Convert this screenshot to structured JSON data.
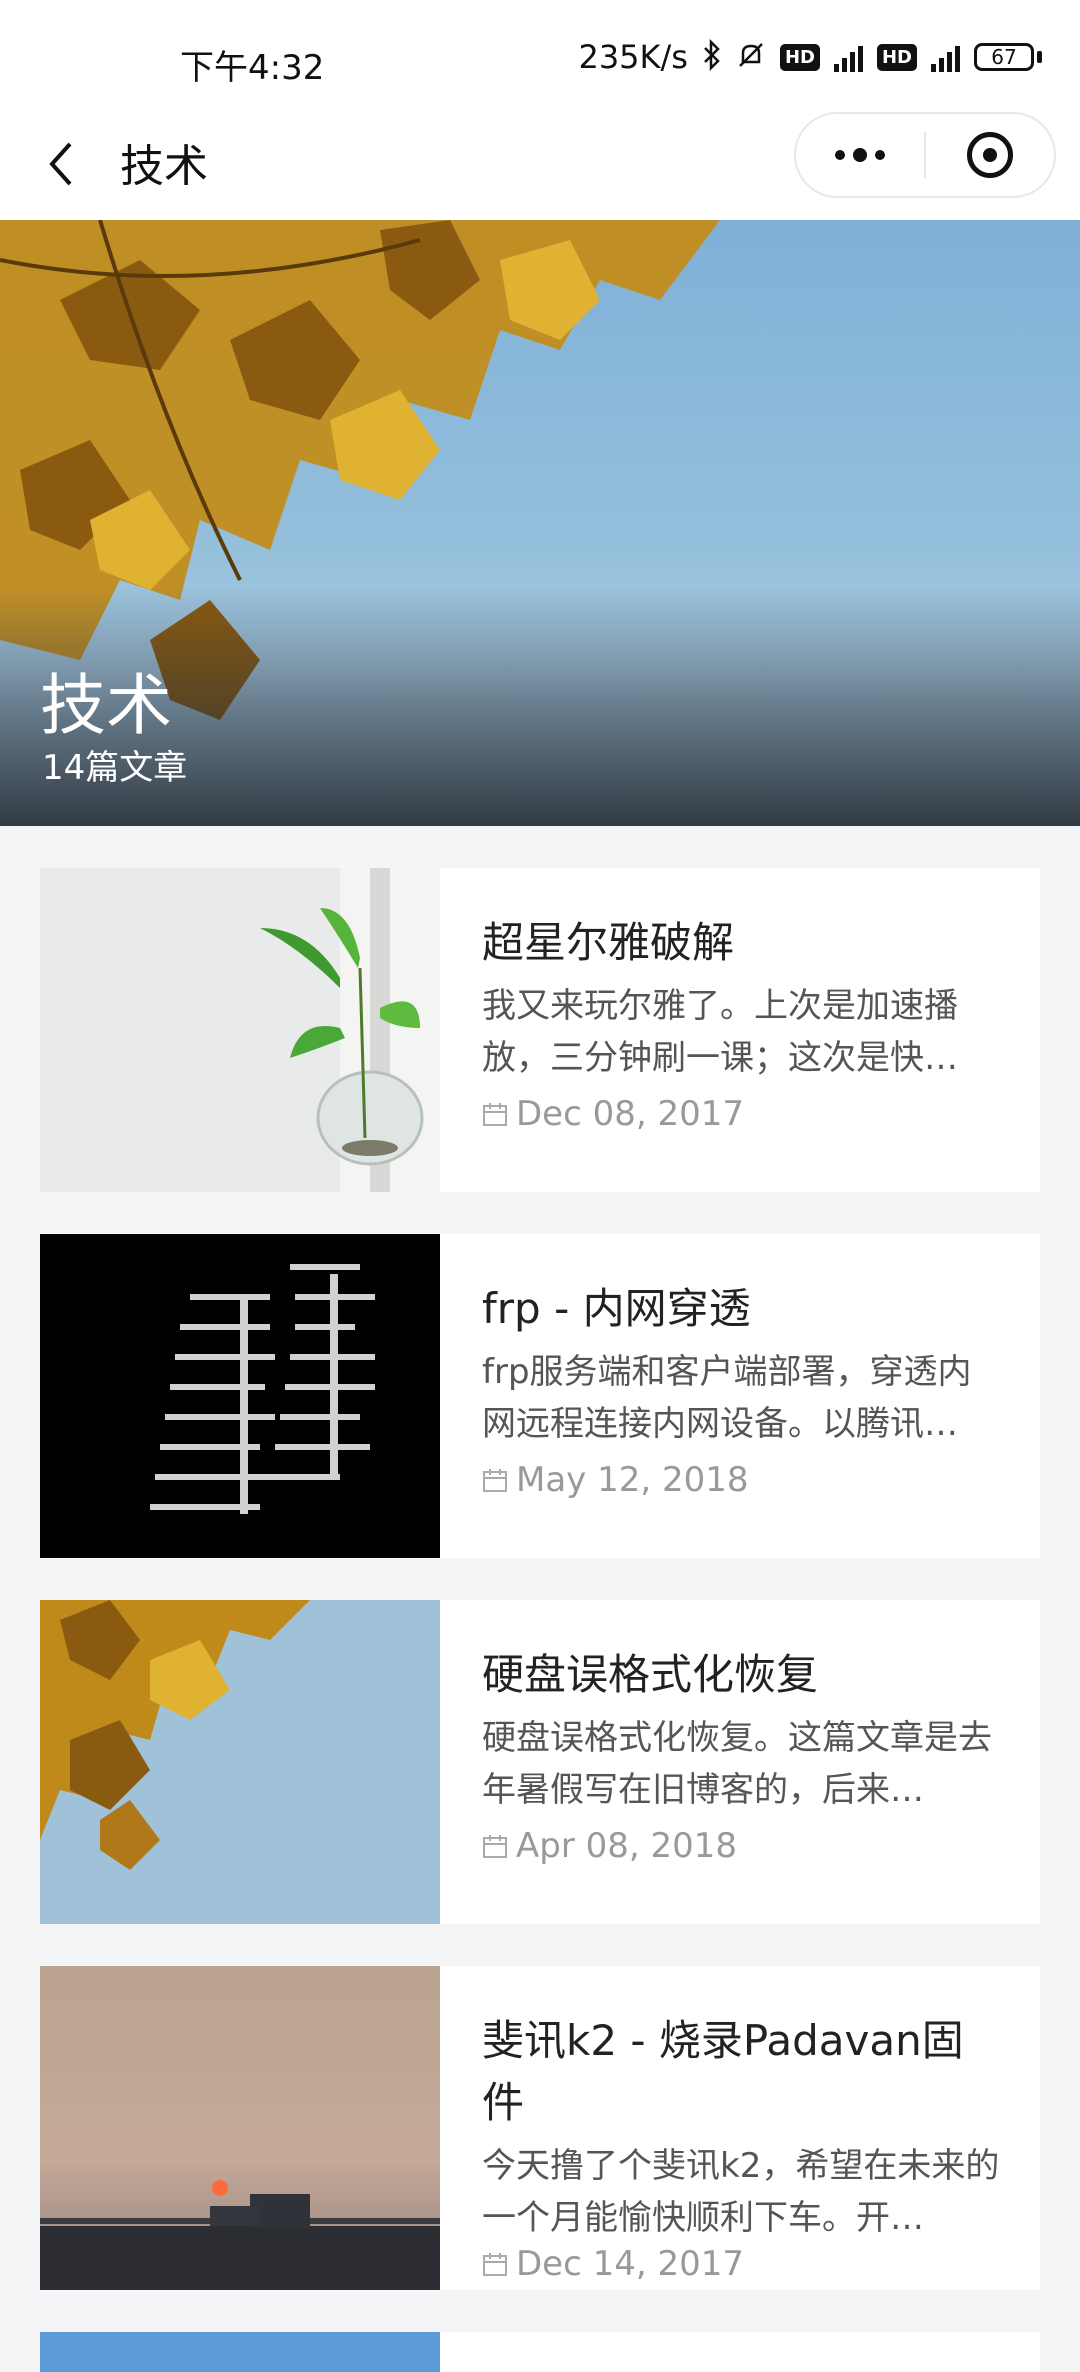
{
  "status_bar": {
    "time": "下午4:32",
    "speed": "235K/s",
    "battery": "67",
    "net1": "4G",
    "net2": "4G",
    "hd": "HD"
  },
  "nav": {
    "title": "技术",
    "back_icon": "chevron-left-icon",
    "more_icon": "more-dots-icon",
    "close_icon": "target-circle-icon"
  },
  "hero": {
    "title": "技术",
    "subtitle": "14篇文章"
  },
  "articles": [
    {
      "title": "超星尔雅破解",
      "excerpt": "我又来玩尔雅了。上次是加速播放，三分钟刷一课；这次是快…",
      "date": "Dec 08, 2017",
      "thumb": "plant-in-glass-vase"
    },
    {
      "title": "frp - 内网穿透",
      "excerpt": "frp服务端和客户端部署，穿透内网远程连接内网设备。以腾讯…",
      "date": "May 12, 2018",
      "thumb": "code-on-dark-screen"
    },
    {
      "title": "硬盘误格式化恢复",
      "excerpt": "硬盘误格式化恢复。这篇文章是去年暑假写在旧博客的，后来…",
      "date": "Apr 08, 2018",
      "thumb": "autumn-leaves-sky"
    },
    {
      "title": "斐讯k2 - 烧录Padavan固件",
      "excerpt": "今天撸了个斐讯k2，希望在未来的一个月能愉快顺利下车。开…",
      "date": "Dec 14, 2017",
      "thumb": "sunset-truck"
    }
  ],
  "colors": {
    "background": "#f4f5f7",
    "card": "#ffffff",
    "date_text": "#999999"
  }
}
